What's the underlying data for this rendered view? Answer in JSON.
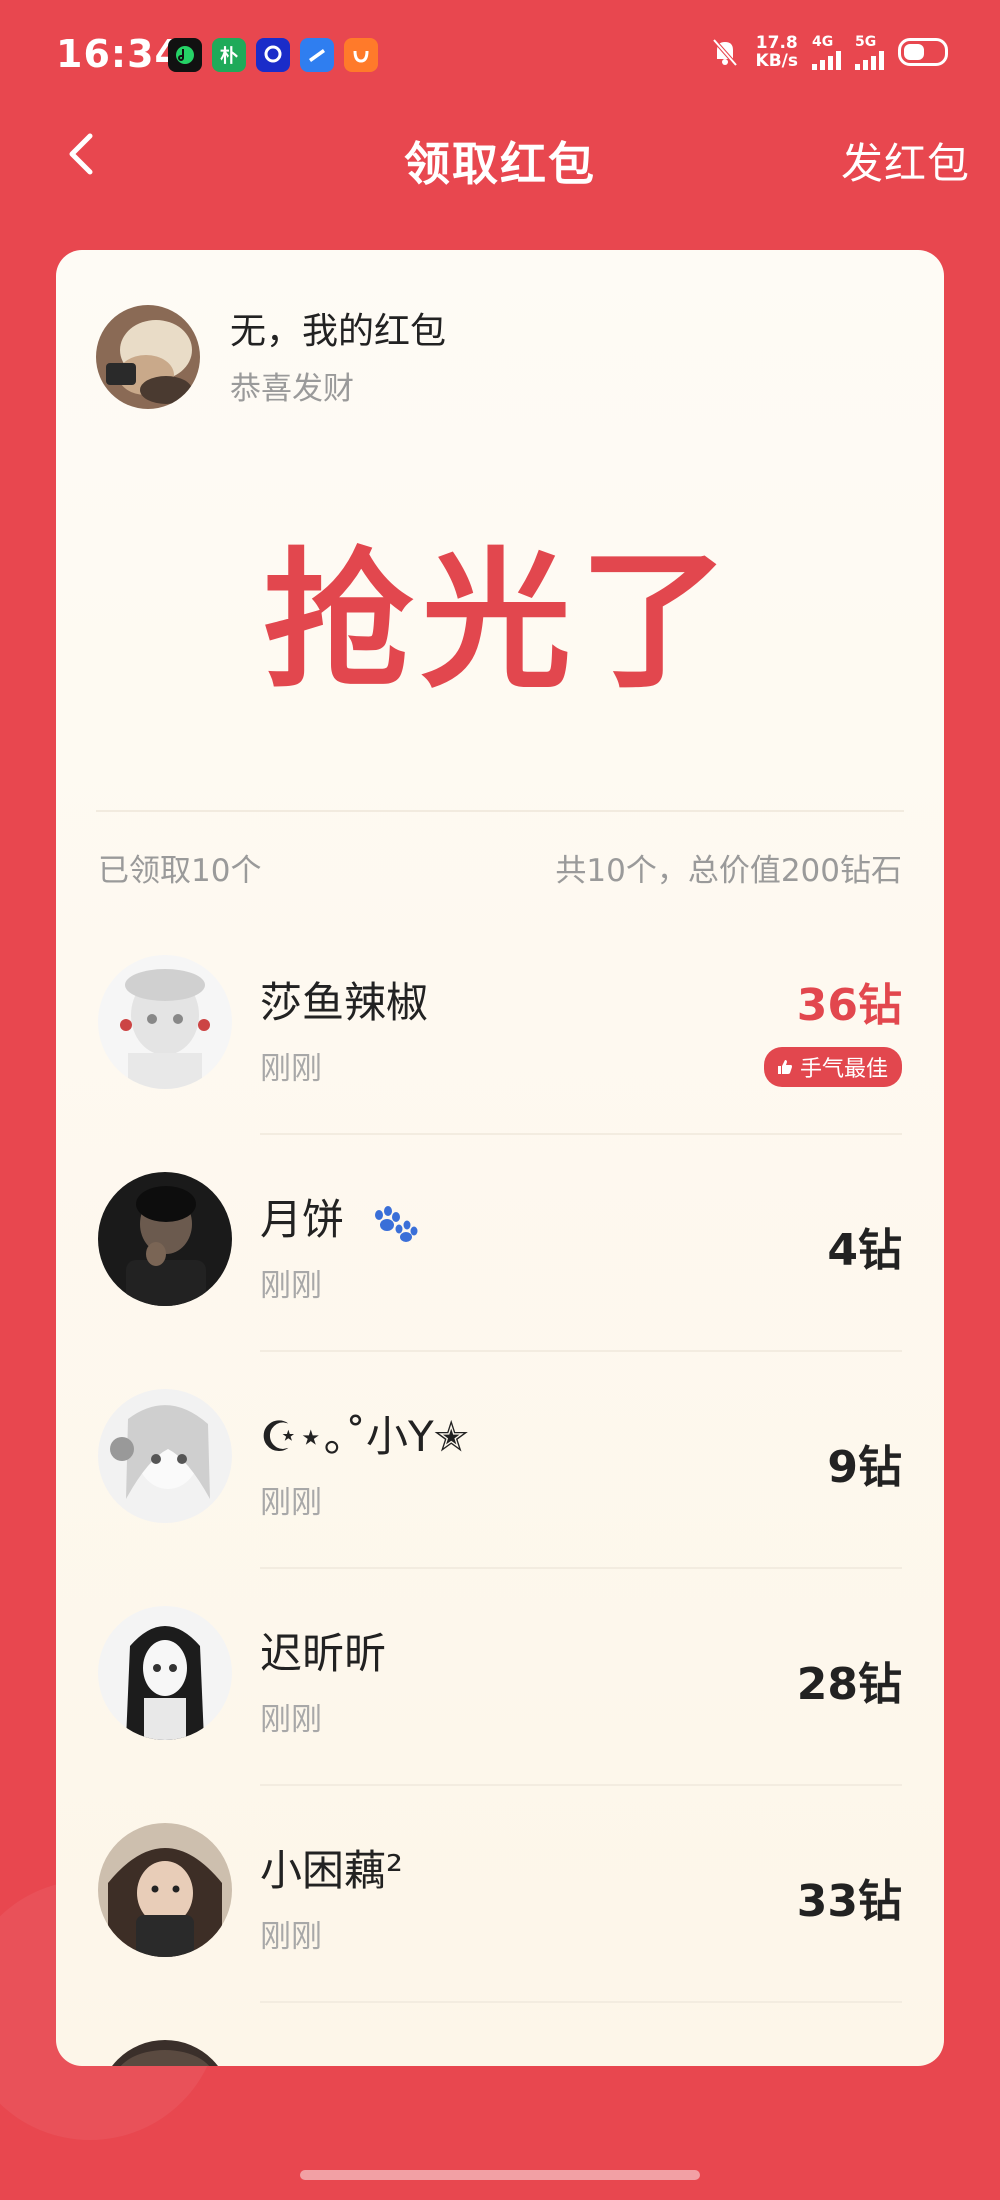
{
  "status_bar": {
    "time": "16:34",
    "net_speed_value": "17.8",
    "net_speed_unit": "KB/s",
    "sim1": "4G",
    "sim2": "5G",
    "app_icons": [
      "music-app",
      "pu-app",
      "browser-app",
      "mail-app",
      "didi-app"
    ],
    "app_icon_labels": [
      "",
      "朴",
      "",
      "",
      ""
    ]
  },
  "nav": {
    "title": "领取红包",
    "send_label": "发红包"
  },
  "sender": {
    "name": "无，我的红包",
    "greeting": "恭喜发财"
  },
  "status_text": "抢光了",
  "summary": {
    "received": "已领取10个",
    "total": "共10个，总价值200钻石"
  },
  "receivers": [
    {
      "name": "莎鱼辣椒",
      "time": "刚刚",
      "amount": "36钻",
      "best": true,
      "best_label": "手气最佳",
      "avatar": "anime-white"
    },
    {
      "name": "月饼",
      "time": "刚刚",
      "amount": "4钻",
      "best": false,
      "avatar": "boy-dark",
      "emoji": "paw-prints-icon"
    },
    {
      "name": "☪⋆｡˚小Y✭",
      "time": "刚刚",
      "amount": "9钻",
      "best": false,
      "avatar": "anime-gray"
    },
    {
      "name": "迟昕昕",
      "time": "刚刚",
      "amount": "28钻",
      "best": false,
      "avatar": "anime-dark-hair"
    },
    {
      "name": "小困藕²",
      "time": "刚刚",
      "amount": "33钻",
      "best": false,
      "avatar": "girl-photo"
    }
  ],
  "colors": {
    "background": "#e8474f",
    "card": "#fefbf5",
    "accent": "#e2474e",
    "muted": "#9a9a9a"
  }
}
